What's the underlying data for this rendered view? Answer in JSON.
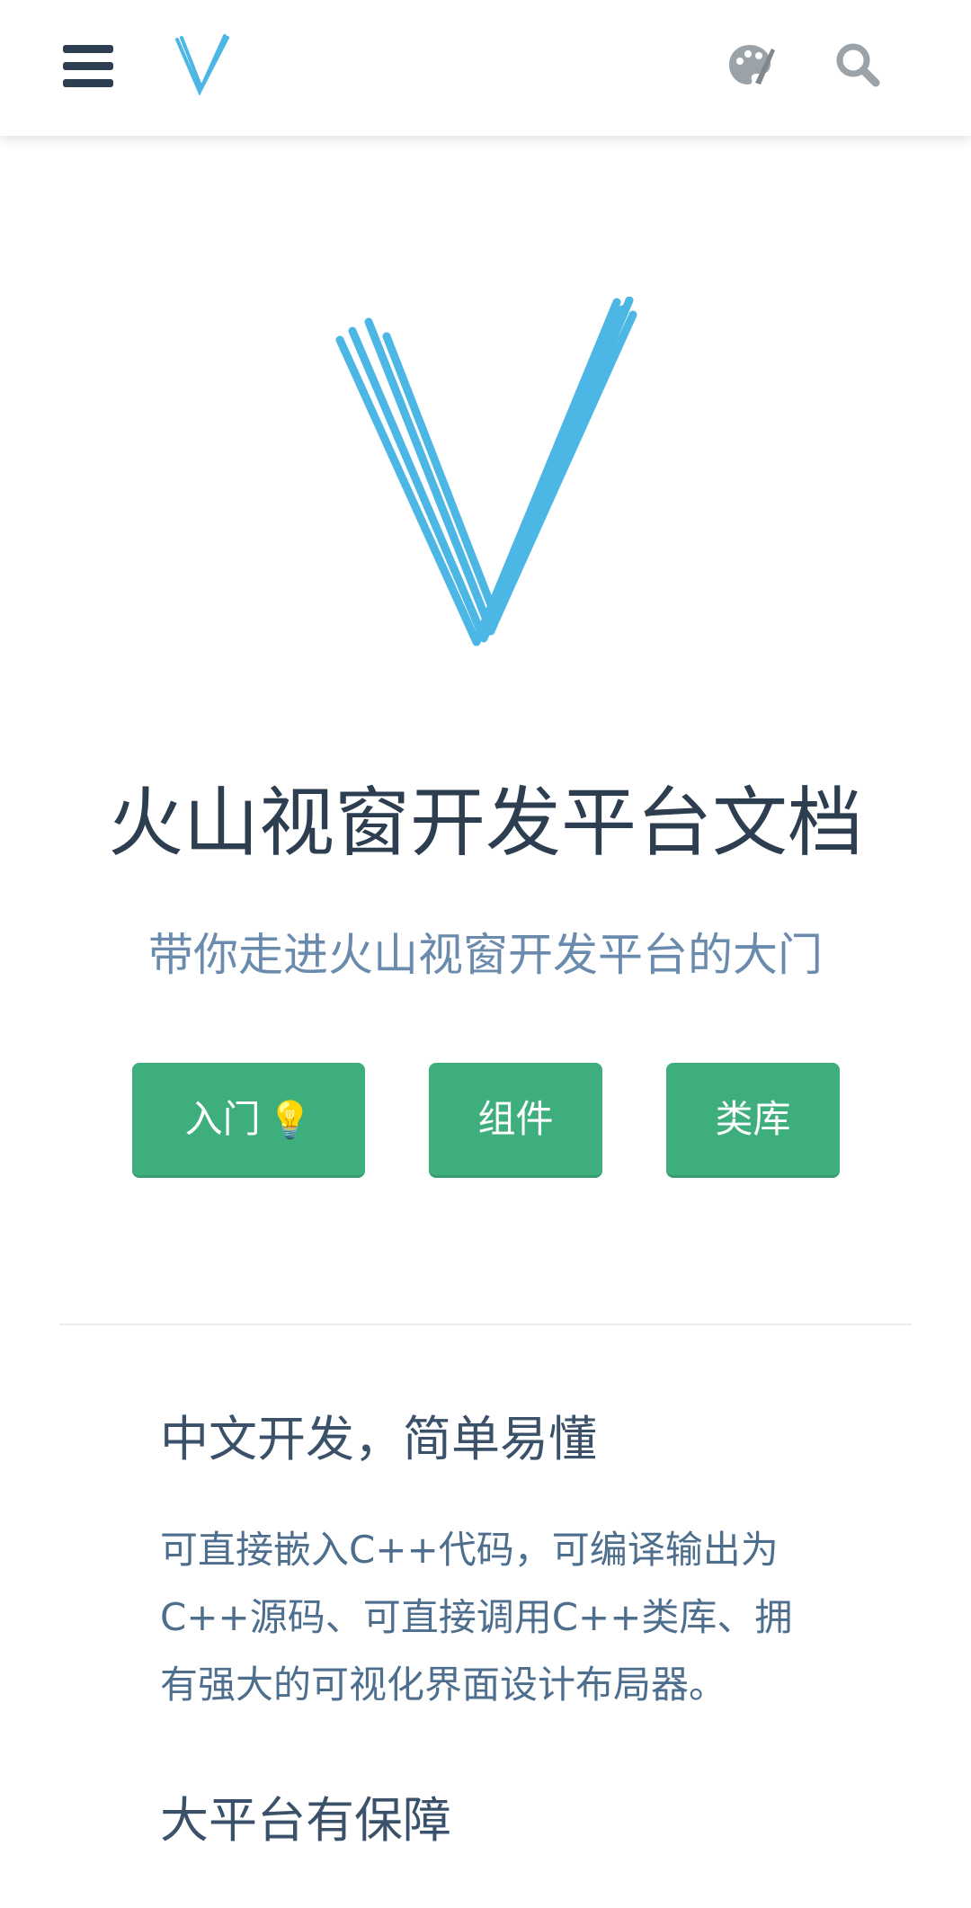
{
  "header": {
    "menu_icon": "hamburger-menu-icon",
    "logo_icon": "v-logo-icon",
    "theme_icon": "palette-icon",
    "search_icon": "search-icon"
  },
  "hero": {
    "logo_icon": "v-logo-large-icon",
    "title": "火山视窗开发平台文档",
    "subtitle": "带你走进火山视窗开发平台的大门"
  },
  "actions": {
    "intro_label": "入门",
    "intro_emoji": "💡",
    "components_label": "组件",
    "library_label": "类库"
  },
  "features": [
    {
      "title": "中文开发，简单易懂",
      "text": "可直接嵌入C++代码，可编译输出为C++源码、可直接调用C++类库、拥有强大的可视化界面设计布局器。"
    },
    {
      "title": "大平台有保障"
    }
  ],
  "colors": {
    "brand": "#3eaf7c",
    "logo_blue": "#4cb6e5",
    "heading": "#2c3e50",
    "subtitle": "#6a8bad"
  }
}
